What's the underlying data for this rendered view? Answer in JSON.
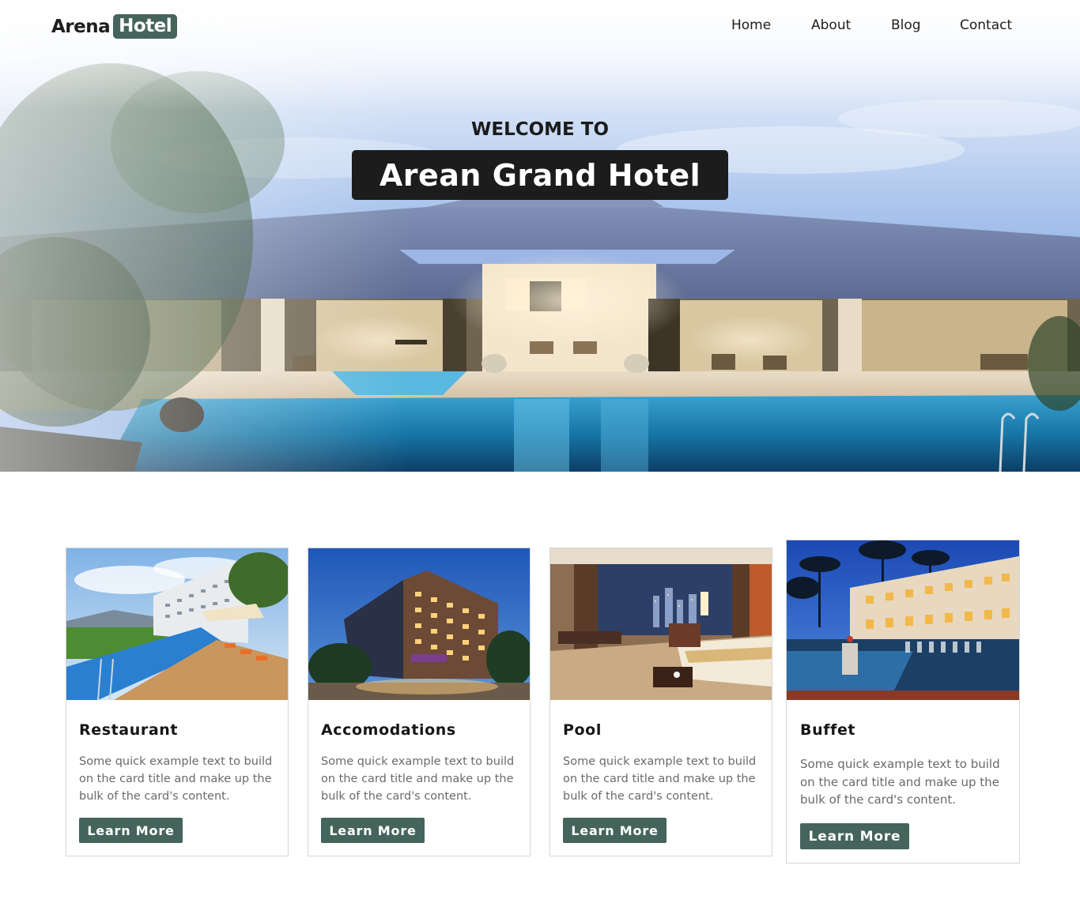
{
  "brand": {
    "word": "Arena",
    "badge": "Hotel"
  },
  "nav": {
    "items": [
      "Home",
      "About",
      "Blog",
      "Contact"
    ]
  },
  "hero": {
    "kicker": "WELCOME TO",
    "title": "Arean Grand Hotel"
  },
  "cards": [
    {
      "title": "Restaurant",
      "text": "Some quick example text to build on the card title and make up the bulk of the card's content.",
      "button": "Learn More"
    },
    {
      "title": "Accomodations",
      "text": "Some quick example text to build on the card title and make up the bulk of the card's content.",
      "button": "Learn More"
    },
    {
      "title": "Pool",
      "text": "Some quick example text to build on the card title and make up the bulk of the card's content.",
      "button": "Learn More"
    },
    {
      "title": "Buffet",
      "text": "Some quick example text to build on the card title and make up the bulk of the card's content.",
      "button": "Learn More"
    }
  ],
  "colors": {
    "accent": "#45645c",
    "title_bg": "#1c1c1c",
    "text_muted": "#6a6a6a"
  }
}
